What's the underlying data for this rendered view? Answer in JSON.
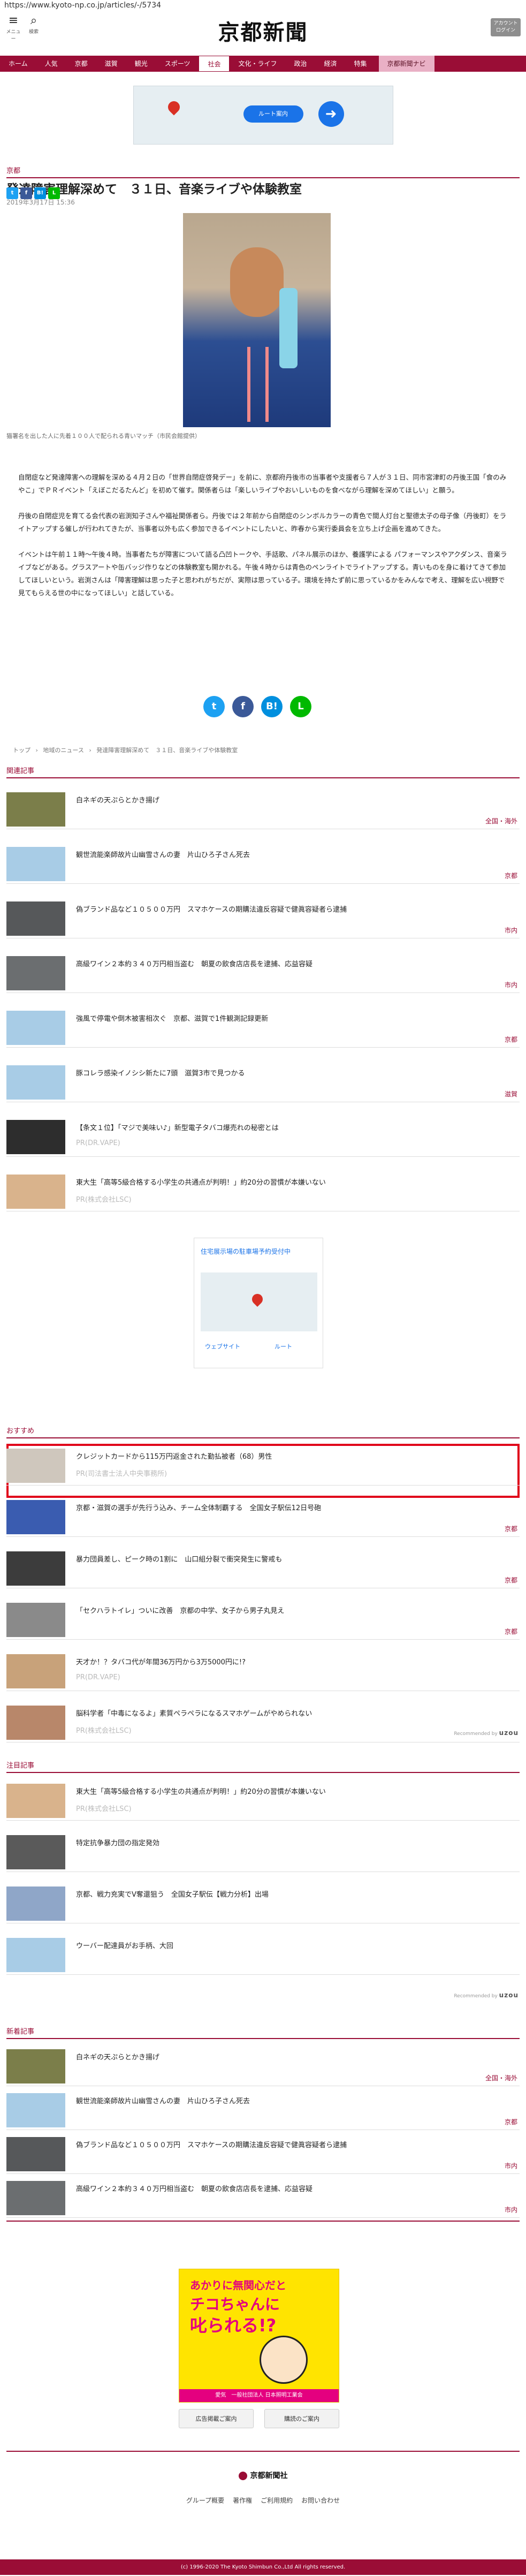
{
  "url": "https://www.kyoto-np.co.jp/articles/-/5734",
  "header": {
    "menu_label": "メニュー",
    "search_label": "検索",
    "logo": "京都新聞",
    "login_label": "アカウント\nログイン"
  },
  "nav": [
    "ホーム",
    "人気",
    "京都",
    "滋賀",
    "観光",
    "スポーツ",
    "社会",
    "文化・ライフ",
    "政治",
    "経済",
    "特集",
    "京都新聞ナビ"
  ],
  "nav_active": 6,
  "top_ad": {
    "button_label": "ルート案内"
  },
  "article": {
    "section": "京都",
    "title": "発達障害理解深めて　３１日、音楽ライブや体験教室",
    "date": "2019年3月17日 15:36",
    "caption": "猫署名を出した人に先着１００人で配られる青いマッチ（市民会館提供）",
    "paragraphs": [
      "自閉症など発達障害への理解を深める４月２日の「世界自閉症啓発デー」を前に、京都府丹後市の当事者や支援者ら７人が３１日、同市宮津町の丹後王国「食のみやこ」でＰＲイベント「えぼこだるたんど」を初めて催す。関係者らは「楽しいライブやおいしいものを食べながら理解を深めてほしい」と願う。",
      "丹後の自閉症児を育てる会代表の岩渕知子さんや福祉関係者ら。丹後では２年前から自閉症のシンボルカラーの青色で間人灯台と聖德太子の母子像（丹後町）をライトアップする催しが行われてきたが、当事者以外も広く参加できるイベントにしたいと、昨春から実行委員会を立ち上げ企画を進めてきた。",
      "イベントは午前１１時～午後４時。当事者たちが障害について語る凸凹トークや、手話歌、パネル展示のほか、養護学による パフォーマンスやアクダンス、音楽ライブなどがある。グラスアートや缶バッジ作りなどの体験教室も開かれる。午後４時からは青色のペンライトでライトアップする。青いものを身に着けてきて参加してほしいという。岩渕さんは「障害理解は思った子と思われがちだが、実際は思っている子。環境を持たず前に思っているかをみんなで考え、理解を広い視野で見てもらえる世の中になってほしい」と話している。"
    ]
  },
  "share_small": [
    "t",
    "f",
    "B!",
    "L"
  ],
  "share_big": [
    "t",
    "f",
    "B!",
    "L"
  ],
  "breadcrumb": [
    "トップ",
    "›",
    "地域のニュース",
    "›",
    "発達障害理解深めて　３１日、音楽ライブや体験教室"
  ],
  "related": {
    "heading": "関連記事",
    "items": [
      {
        "title": "白ネギの天ぷらとかき揚げ",
        "tag": "全国・海外"
      },
      {
        "title": "観世流能楽師故片山幽雪さんの妻　片山ひろ子さん死去",
        "tag": "京都"
      },
      {
        "title": "偽ブランド品など１０５００万円　スマホケースの期購法違反容疑で健眞容疑者ら逮捕",
        "tag": "市内"
      },
      {
        "title": "高級ワイン２本約３４０万円相当盗む　朝夏の飲食店店長を逮捕、応益容疑",
        "tag": "市内"
      },
      {
        "title": "強風で停電や倒木被害相次ぐ　京都、滋賀で1件観測記録更新",
        "tag": "京都"
      },
      {
        "title": "豚コレラ感染イノシシ新たに7頭　滋賀3市で見つかる",
        "tag": "滋賀"
      },
      {
        "title": "【条文１位】「マジで美味い♪」新型電子タバコ爆売れの秘密とは",
        "sub": "PR(DR.VAPE)"
      },
      {
        "title": "東大生「高等5級合格する小学生の共通点が判明！」約20分の習慣が本嫌いない",
        "sub": "PR(株式会社LSC)"
      }
    ]
  },
  "mid_ad": {
    "title": "住宅展示場の駐車場予約受付中",
    "btn1": "ウェブサイト",
    "btn2": "ルート"
  },
  "recommended": {
    "heading": "おすすめ",
    "items": [
      {
        "title": "クレジットカードから115万円返金された勤払被者（68）男性",
        "sub": "PR(司法書士法人中央事務所)"
      },
      {
        "title": "京都・滋賀の選手が先行う込み、チーム全体制覇する　全国女子駅伝12日号砲",
        "tag": "京都"
      },
      {
        "title": "暴力団員差し、ピーク時の1割に　山口組分裂で衝突発生に警戒も",
        "tag": "京都"
      },
      {
        "title": "「セクハラトイレ」ついに改善　京都の中学、女子から男子丸見え",
        "tag": "京都"
      },
      {
        "title": "天才か！？タバコ代が年間36万円から3万5000円に!?",
        "sub": "PR(DR.VAPE)"
      },
      {
        "title": "脳科学者「中毒になるよ」素質ペラペラになるスマホゲームがやめられない",
        "sub": "PR(株式会社LSC)"
      }
    ],
    "powered": "Recommended by",
    "powered_brand": "uzou"
  },
  "attention": {
    "heading": "注目記事",
    "items": [
      {
        "title": "東大生「高等5級合格する小学生の共通点が判明！」約20分の習慣が本嫌いない",
        "sub": "PR(株式会社LSC)"
      },
      {
        "title": "特定抗争暴力団の指定発効"
      },
      {
        "title": "京都、戦力充実でV奪還狙う　全国女子駅伝【戦力分析】出場"
      },
      {
        "title": "ウーバー配達員がお手柄、大回"
      }
    ],
    "powered": "Recommended by",
    "powered_brand": "uzou"
  },
  "newest": {
    "heading": "新着記事",
    "items": [
      {
        "title": "白ネギの天ぷらとかき揚げ",
        "tag": "全国・海外"
      },
      {
        "title": "観世流能楽師故片山幽雪さんの妻　片山ひろ子さん死去",
        "tag": "京都"
      },
      {
        "title": "偽ブランド品など１０５００万円　スマホケースの期購法違反容疑で健眞容疑者ら逮捕",
        "tag": "市内"
      },
      {
        "title": "高級ワイン２本約３４０万円相当盗む　朝夏の飲食店店長を逮捕、応益容疑",
        "tag": "市内"
      }
    ]
  },
  "bottom_ad": {
    "line1": "あかりに無関心だと",
    "line2": "チコちゃんに",
    "line3": "叱られる!?",
    "footer": "愛気　一般社団法人 日本照明工業会",
    "btn1": "広告掲載ご案内",
    "btn2": "購読のご案内"
  },
  "footer": {
    "brand": "京都新聞社",
    "links": [
      "グループ概要",
      "著作権",
      "ご利用規約",
      "お問い合わせ"
    ],
    "copyright": "(c) 1996-2020 The Kyoto Shimbun Co.,Ltd All rights reserved."
  }
}
